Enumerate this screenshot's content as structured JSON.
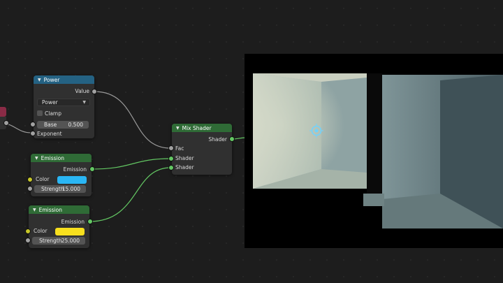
{
  "nodes": {
    "power": {
      "title": "Power",
      "output_value": "Value",
      "operation": "Power",
      "clamp_label": "Clamp",
      "base_label": "Base",
      "base_value": "0.500",
      "exponent_label": "Exponent"
    },
    "emission1": {
      "title": "Emission",
      "output": "Emission",
      "color_label": "Color",
      "color": "#2ab6f4",
      "strength_label": "Strength",
      "strength_value": "15.000"
    },
    "emission2": {
      "title": "Emission",
      "output": "Emission",
      "color_label": "Color",
      "color": "#f7df1e",
      "strength_label": "Strength",
      "strength_value": "25.000"
    },
    "mix": {
      "title": "Mix Shader",
      "output": "Shader",
      "fac_label": "Fac",
      "shader1_label": "Shader",
      "shader2_label": "Shader"
    }
  },
  "colors": {
    "socket_float": "#a1a1a1",
    "socket_shader": "#63c763",
    "socket_color": "#c7c729",
    "header_math": "#246283",
    "header_shader": "#2f6b36"
  },
  "icons": {
    "collapse": "chevron-down-icon",
    "light_gizmo": "light-gizmo-icon"
  }
}
